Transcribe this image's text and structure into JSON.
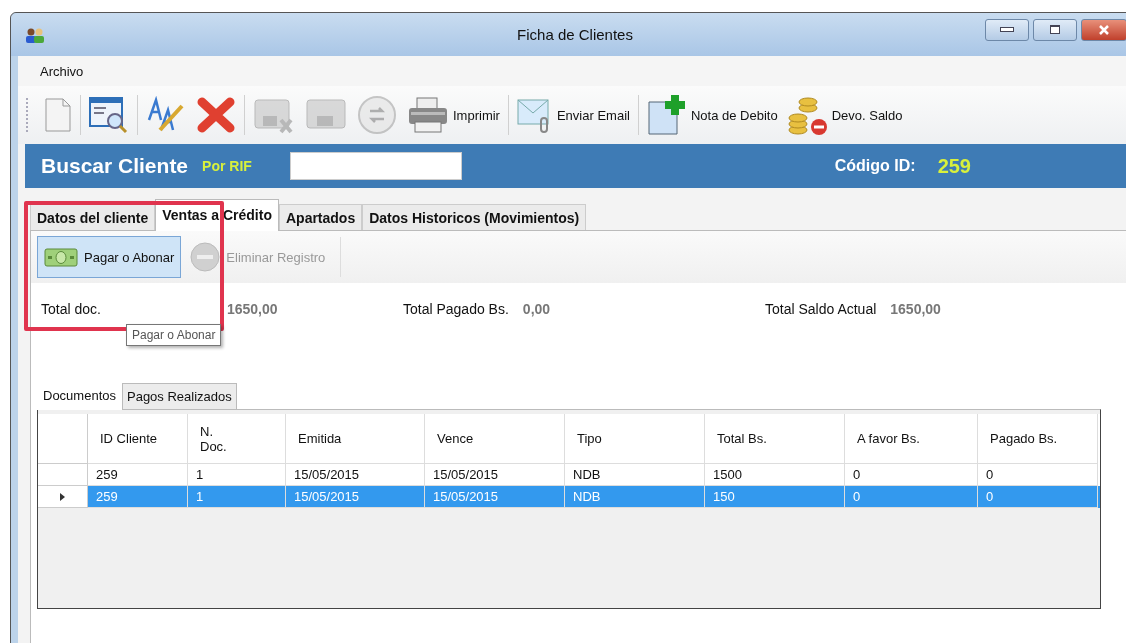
{
  "window": {
    "title": "Ficha de Clientes"
  },
  "menu": [
    "Archivo"
  ],
  "toolbar": [
    {
      "disabled": false
    },
    {
      "disabled": false
    },
    {
      "disabled": false
    },
    {
      "disabled": false
    },
    {
      "disabled": true
    },
    {
      "disabled": true
    },
    {
      "disabled": true
    },
    {
      "label": "Imprimir",
      "disabled": false
    },
    {
      "label": "Enviar Email",
      "disabled": false
    },
    {
      "label": "Nota de Debito",
      "disabled": false
    },
    {
      "label": "Devo. Saldo",
      "disabled": false
    }
  ],
  "search": {
    "title": "Buscar Cliente",
    "filter": "Por RIF",
    "code_label": "Código ID:",
    "code_value": "259"
  },
  "tabs": [
    {
      "label": "Datos del cliente",
      "selected": false
    },
    {
      "label": "Ventas a Crédito",
      "selected": true
    },
    {
      "label": "Apartados",
      "selected": false
    },
    {
      "label": "Datos Historicos (Movimientos)",
      "selected": false
    }
  ],
  "actions": [
    {
      "label": "Pagar o Abonar",
      "disabled": false,
      "hovered": true
    },
    {
      "label": "Eliminar Registro",
      "disabled": true,
      "hovered": false
    }
  ],
  "tooltip": "Pagar o Abonar",
  "highlight_box": true,
  "totals": [
    {
      "label": "Total doc.",
      "value": "1650,00"
    },
    {
      "label": "Total Pagado Bs.",
      "value": "0,00"
    },
    {
      "label": "Total Saldo Actual",
      "value": "1650,00"
    }
  ],
  "subtabs": [
    {
      "label": "Documentos",
      "selected": true
    },
    {
      "label": "Pagos Realizados",
      "selected": false
    }
  ],
  "table": {
    "columns": [
      "ID Cliente",
      "N.\nDoc.",
      "Emitida",
      "Vence",
      "Tipo",
      "Total Bs.",
      "A favor Bs.",
      "Pagado Bs."
    ],
    "rows": [
      {
        "cells": [
          "259",
          "1",
          "15/05/2015",
          "15/05/2015",
          "NDB",
          "1500",
          "0",
          "0"
        ],
        "selected": false
      },
      {
        "cells": [
          "259",
          "1",
          "15/05/2015",
          "15/05/2015",
          "NDB",
          "150",
          "0",
          "0"
        ],
        "selected": true
      }
    ]
  }
}
